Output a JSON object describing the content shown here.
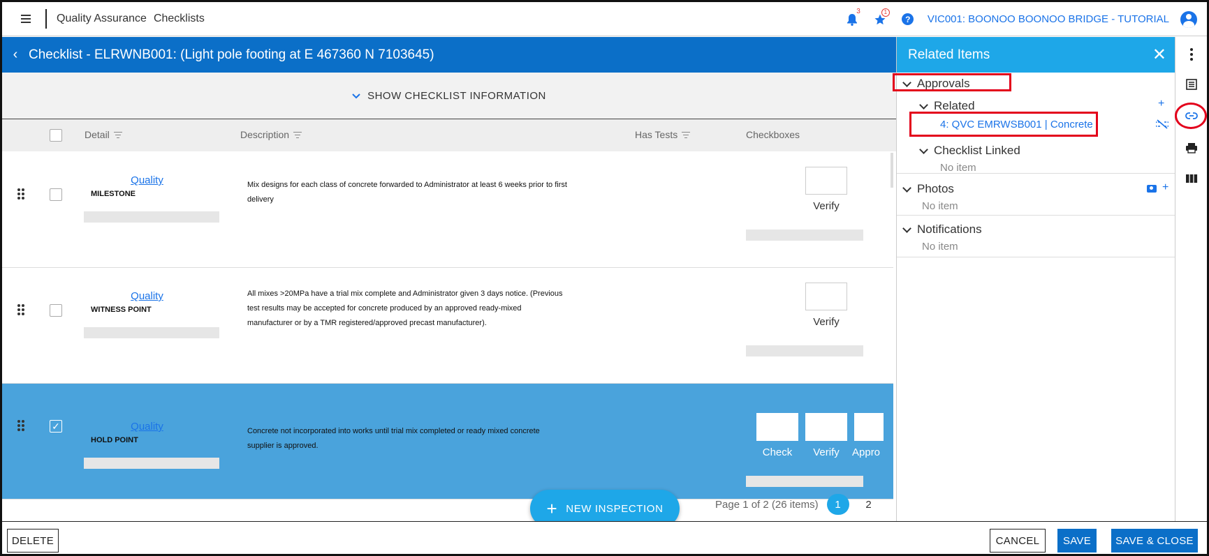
{
  "topbar": {
    "app_title": "Quality Assurance",
    "section": "Checklists",
    "notification_count": "3",
    "favorites_badge": "1",
    "help_glyph": "?",
    "project": "VIC001: BOONOO BOONOO BRIDGE - TUTORIAL"
  },
  "checklist": {
    "title": "Checklist - ELRWNB001: (Light pole footing at E 467360 N 7103645)",
    "show_info": "SHOW CHECKLIST INFORMATION",
    "columns": {
      "detail": "Detail",
      "description": "Description",
      "has_tests": "Has Tests",
      "checkboxes": "Checkboxes"
    },
    "rows": [
      {
        "link": "Quality",
        "type": "MILESTONE",
        "description": "Mix designs for each class of concrete forwarded to Administrator at least 6 weeks prior to first delivery",
        "checks": [
          "Verify"
        ],
        "selected": false
      },
      {
        "link": "Quality",
        "type": "WITNESS POINT",
        "description": "All mixes >20MPa have a trial mix complete and Administrator given 3 days notice.  (Previous test results may be accepted for concrete produced by an approved ready-mixed manufacturer or by a TMR registered/approved precast manufacturer).",
        "checks": [
          "Verify"
        ],
        "selected": false
      },
      {
        "link": "Quality",
        "type": "HOLD POINT",
        "description": "Concrete not incorporated into works until trial mix completed or ready mixed concrete supplier is approved.",
        "checks": [
          "Check",
          "Verify",
          "Appro"
        ],
        "selected": true
      }
    ],
    "new_inspection": "NEW INSPECTION",
    "pager": {
      "summary": "Page 1 of 2 (26 items)",
      "pages": [
        "1",
        "2"
      ],
      "current": 1
    }
  },
  "related": {
    "title": "Related Items",
    "approvals": "Approvals",
    "related_label": "Related",
    "related_item": "4: QVC EMRWSB001 | Concrete",
    "checklist_linked": "Checklist Linked",
    "photos": "Photos",
    "notifications": "Notifications",
    "no_item": "No item"
  },
  "footer": {
    "delete": "DELETE",
    "cancel": "CANCEL",
    "save": "SAVE",
    "save_close": "SAVE & CLOSE"
  },
  "colors": {
    "primary": "#0b6fc8",
    "accent": "#1ea7e8",
    "selected_row": "#4aa3dc",
    "highlight": "#e3001b"
  }
}
